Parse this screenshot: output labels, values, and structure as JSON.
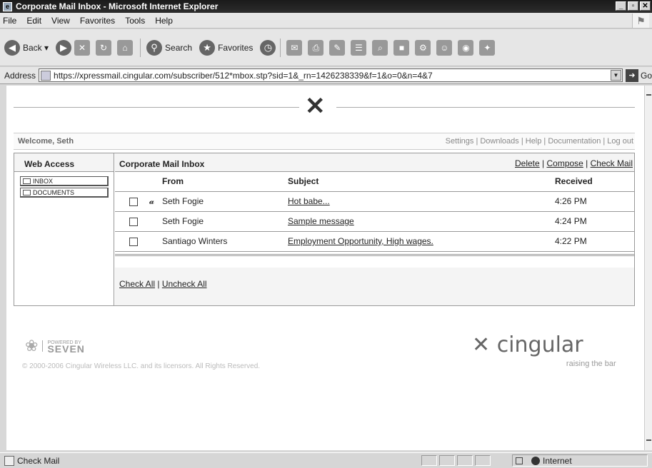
{
  "window": {
    "title": "Corporate Mail Inbox - Microsoft Internet Explorer",
    "controls": [
      "_",
      "ᵀ",
      "X"
    ]
  },
  "menu": [
    "File",
    "Edit",
    "View",
    "Favorites",
    "Tools",
    "Help"
  ],
  "toolbar": {
    "back": "Back",
    "search": "Search",
    "favorites": "Favorites"
  },
  "address": {
    "label": "Address",
    "url": "https://xpressmail.cingular.com/subscriber/512*mbox.stp?sid=1&_rn=1426238339&f=1&o=0&n=4&7",
    "go": "Go"
  },
  "page": {
    "welcome": "Welcome, Seth",
    "top_links": "Settings | Downloads | Help | Documentation | Log out",
    "web_access_title": "Web Access",
    "nav": [
      "INBOX",
      "DOCUMENTS"
    ],
    "inbox_title": "Corporate Mail Inbox",
    "actions": {
      "delete": "Delete",
      "compose": "Compose",
      "check_mail": "Check Mail"
    },
    "columns": {
      "from": "From",
      "subject": "Subject",
      "received": "Received"
    },
    "messages": [
      {
        "attachment": true,
        "from": "Seth Fogie",
        "subject": "Hot babe...",
        "received": "4:26 PM"
      },
      {
        "attachment": false,
        "from": "Seth Fogie",
        "subject": "Sample message",
        "received": "4:24 PM"
      },
      {
        "attachment": false,
        "from": "Santiago Winters",
        "subject": "Employment Opportunity, High wages.",
        "received": "4:22 PM"
      }
    ],
    "check_all": "Check All",
    "uncheck_all": "Uncheck All",
    "powered_by": "POWERED BY",
    "seven": "SEVEN",
    "copyright": "© 2000-2006 Cingular Wireless LLC. and its licensors. All Rights Reserved.",
    "cingular": "cingular",
    "tagline": "raising the bar"
  },
  "status": {
    "text": "Check Mail",
    "zone": "Internet"
  }
}
